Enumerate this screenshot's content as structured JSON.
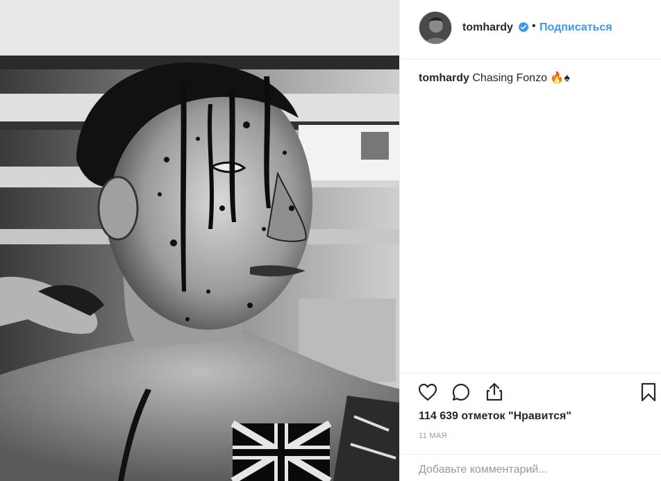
{
  "post": {
    "username": "tomhardy",
    "separator": "•",
    "follow_label": "Подписаться",
    "caption": {
      "username": "tomhardy",
      "text": "Chasing Fonzo 🔥♠"
    },
    "likes_text": "114 639 отметок \"Нравится\"",
    "date_text": "11 мая",
    "comment_placeholder": "Добавьте комментарий..."
  },
  "photo": {
    "description": "black and white close-up portrait of a man with blood-splattered face and painted Union Jack on chest"
  },
  "icons": {
    "verified": "verified-badge-icon",
    "like": "heart-icon",
    "comment": "comment-icon",
    "share": "share-icon",
    "save": "bookmark-icon"
  },
  "colors": {
    "link_blue": "#3897f0",
    "text": "#262626",
    "muted": "#999999",
    "divider": "#efefef"
  }
}
